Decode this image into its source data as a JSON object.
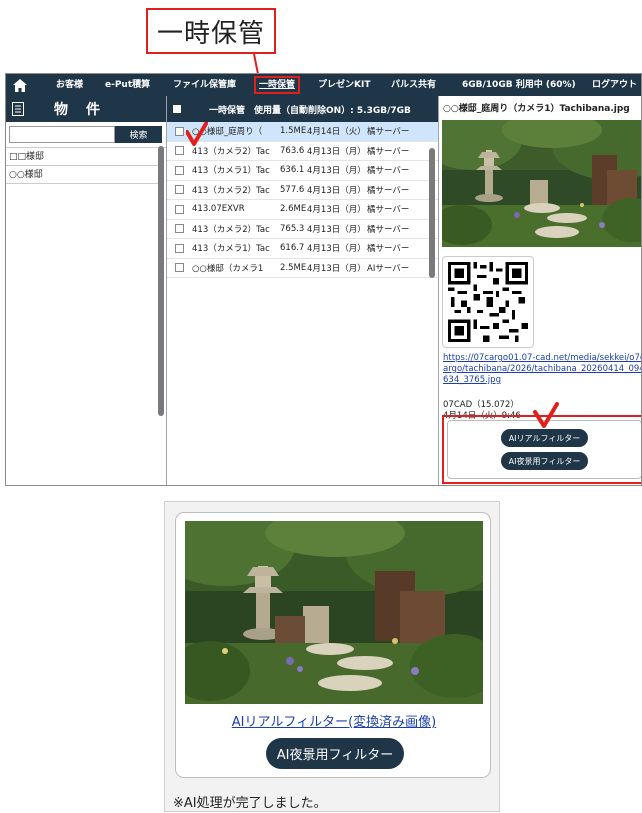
{
  "callout": {
    "label": "一時保管"
  },
  "nav": {
    "home_icon": "home-icon",
    "items": [
      {
        "label": "お客様"
      },
      {
        "label": "e-Put積算"
      },
      {
        "label": "ファイル保管庫"
      },
      {
        "label": "一時保管"
      },
      {
        "label": "プレゼンKIT"
      },
      {
        "label": "パルス共有"
      },
      {
        "label": "6GB/10GB 利用中 (60%)"
      },
      {
        "label": "ログアウト"
      }
    ]
  },
  "left": {
    "title": "物件",
    "search_placeholder": "",
    "search_button": "検索",
    "properties": [
      "□□様邸",
      "○○様邸"
    ]
  },
  "middle": {
    "header": "一時保管　使用量（自動削除ON）: 5.3GB/7GB",
    "files": [
      {
        "name": "○○様邸_庭周り（",
        "size": "1.5ME",
        "date": "4月14日（火）",
        "owner": "橘サーバー"
      },
      {
        "name": "413（カメラ2）Tac",
        "size": "763.6",
        "date": "4月13日（月）",
        "owner": "橘サーバー"
      },
      {
        "name": "413（カメラ1）Tac",
        "size": "636.1",
        "date": "4月13日（月）",
        "owner": "橘サーバー"
      },
      {
        "name": "413（カメラ2）Tac",
        "size": "577.6",
        "date": "4月13日（月）",
        "owner": "橘サーバー"
      },
      {
        "name": "413.07EXVR",
        "size": "2.6ME",
        "date": "4月13日（月）",
        "owner": "橘サーバー"
      },
      {
        "name": "413（カメラ2）Tac",
        "size": "765.3",
        "date": "4月13日（月）",
        "owner": "橘サーバー"
      },
      {
        "name": "413（カメラ1）Tac",
        "size": "616.7",
        "date": "4月13日（月）",
        "owner": "橘サーバー"
      },
      {
        "name": "○○様邸（カメラ1",
        "size": "2.5ME",
        "date": "4月13日（月）",
        "owner": "AIサーバー"
      }
    ]
  },
  "right": {
    "title": "○○様邸_庭周り（カメラ1）Tachibana.jpg",
    "link": "https://07cargo01.07-cad.net/media/sekkei/o7cargo/tachibana/2026/tachibana_20260414_094634_3765.jpg",
    "app_version": "07CAD（15.072）",
    "timestamp": "4月14日（火）9:46",
    "filter_real": "AIリアルフィルター",
    "filter_night": "AI夜景用フィルター"
  },
  "card": {
    "link": "AIリアルフィルター(変換済み画像)",
    "button": "AI夜景用フィルター",
    "notice": "※AI処理が完了しました。"
  },
  "colors": {
    "nav_bg": "#1f3548",
    "accent_red": "#e0201c",
    "link": "#1a3fb4",
    "selected_row": "#cfe5fb"
  }
}
